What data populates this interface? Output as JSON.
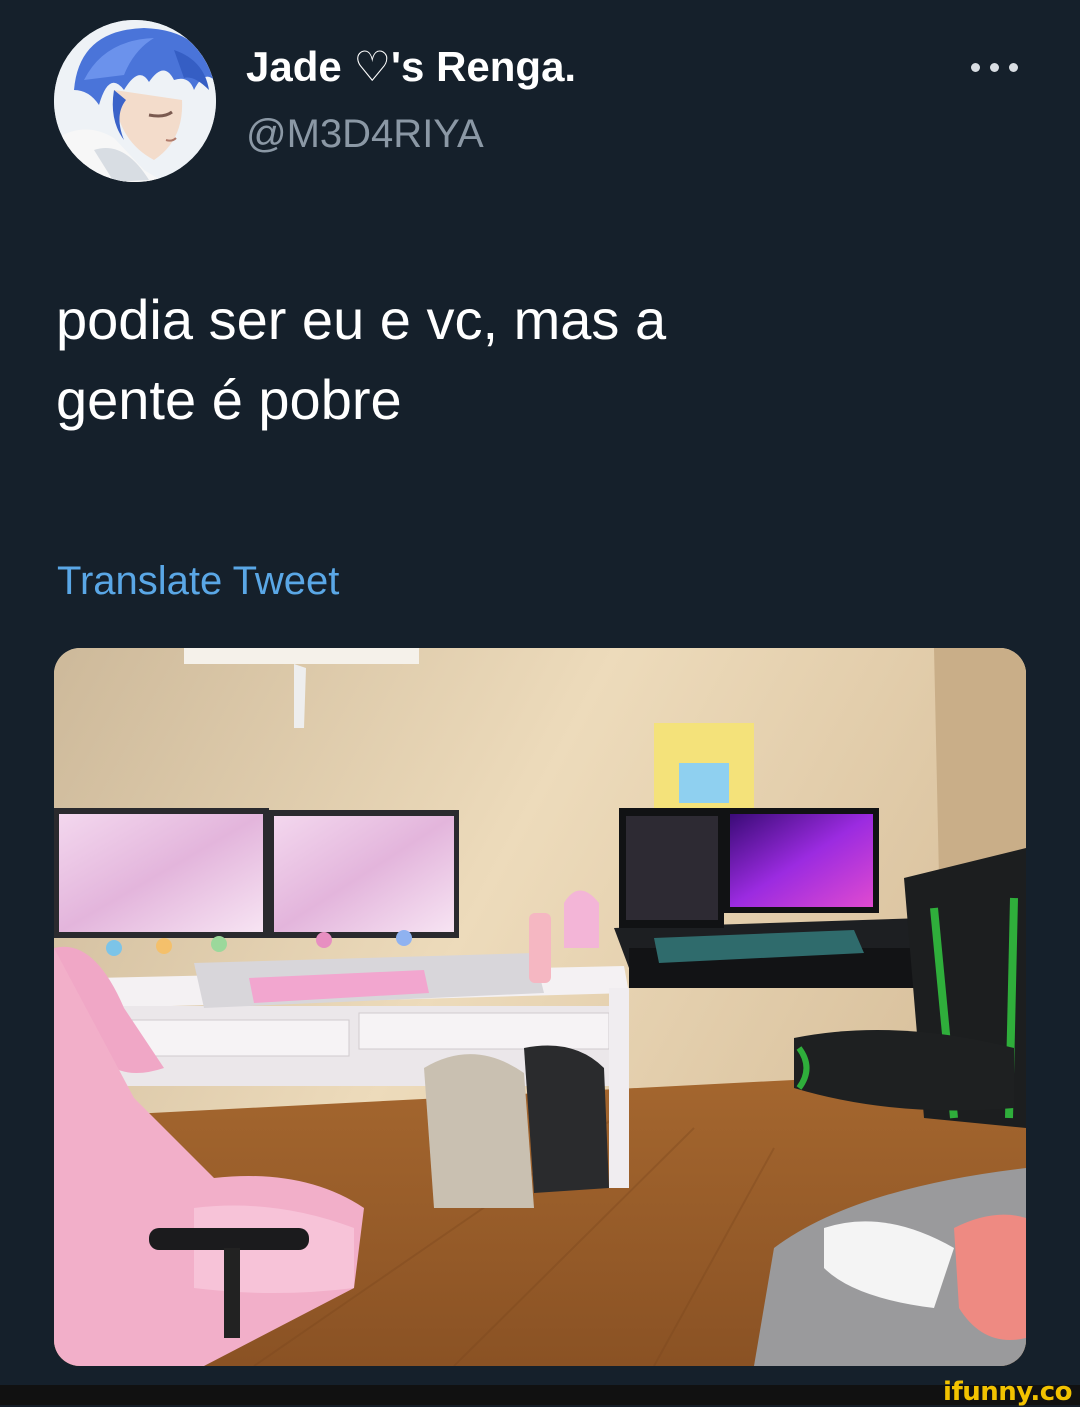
{
  "tweet": {
    "display_name": "Jade ♡'s Renga.",
    "handle": "@M3D4RIYA",
    "text_line_1": "podia ser eu e vc, mas a",
    "text_line_2": "gente é pobre",
    "translate_label": "Translate Tweet",
    "more_icon": "more-horizontal-icon",
    "avatar_icon": "anime-avatar-blue-hair"
  },
  "media": {
    "image_name": "photo-gaming-room-pink-and-green-setups"
  },
  "watermark": {
    "text": "ifunny.co"
  },
  "colors": {
    "background": "#15202b",
    "name": "#ffffff",
    "handle": "#8b98a5",
    "link": "#5aa7e6",
    "watermark": "#f2c200"
  }
}
